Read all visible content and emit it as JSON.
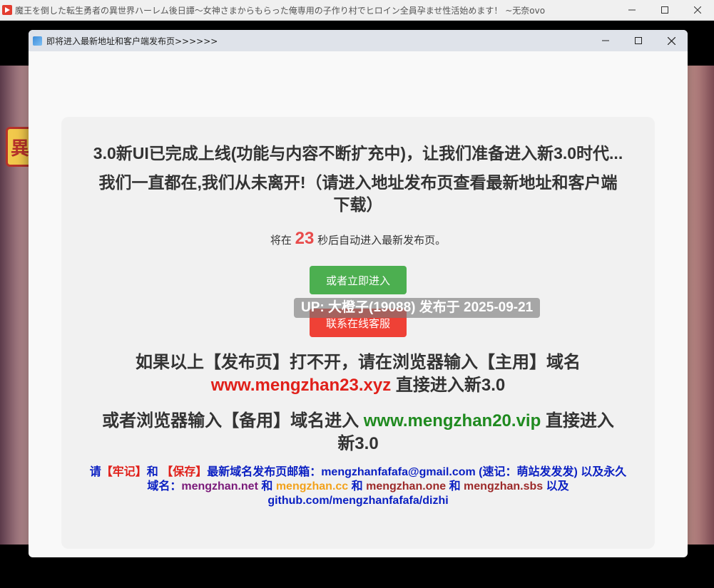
{
  "outer_window": {
    "title": "魔王を倒した転生勇者の異世界ハーレム後日譚～女神さまからもらった俺専用の子作り村でヒロイン全員孕ませ性活始めます！ ~无奈ovo"
  },
  "dialog": {
    "title": "即将进入最新地址和客户端发布页>>>>>>",
    "headline1": "3.0新UI已完成上线(功能与内容不断扩充中)，让我们准备进入新3.0时代...",
    "headline2": "我们一直都在,我们从未离开!（请进入地址发布页查看最新地址和客户端下载）",
    "countdown_prefix": "将在",
    "countdown_seconds": "23",
    "countdown_suffix": "秒后自动进入最新发布页。",
    "enter_button": "或者立即进入",
    "service_button": "联系在线客服",
    "up_overlay": "UP: 大橙子(19088) 发布于 2025-09-21",
    "domain1_prefix": "如果以上【发布页】打不开，请在浏览器输入【主用】域名",
    "domain1_url": "www.mengzhan23.xyz",
    "domain1_suffix": "直接进入新3.0",
    "domain2_prefix": "或者浏览器输入【备用】域名进入",
    "domain2_url": "www.mengzhan20.vip",
    "domain2_suffix": "直接进入新3.0",
    "note": {
      "p1": "请",
      "keep": "【牢记】",
      "p2": "和",
      "save": "【保存】",
      "p3": "最新域名发布页邮箱：mengzhanfafafa@gmail.com (速记：萌站发发发) 以及永久域名：",
      "d1": "mengzhan.net",
      "and1": "和",
      "d2": "mengzhan.cc",
      "and2": "和",
      "d3": "mengzhan.one",
      "and3": "和",
      "d4": "mengzhan.sbs",
      "p4": "以及 github.com/mengzhanfafafa/dizhi"
    }
  },
  "colors": {
    "countdown_number": "#e84b4b",
    "enter_button": "#4caf50",
    "service_button": "#ef4136",
    "primary_domain": "#e0201a",
    "backup_domain": "#1f8a1f",
    "note_text": "#0a1fc2"
  },
  "icons": {
    "outer_app": "play-icon",
    "dialog_app": "dialog-app-icon",
    "minimize": "minimize-icon",
    "maximize": "maximize-icon",
    "close": "close-icon"
  }
}
